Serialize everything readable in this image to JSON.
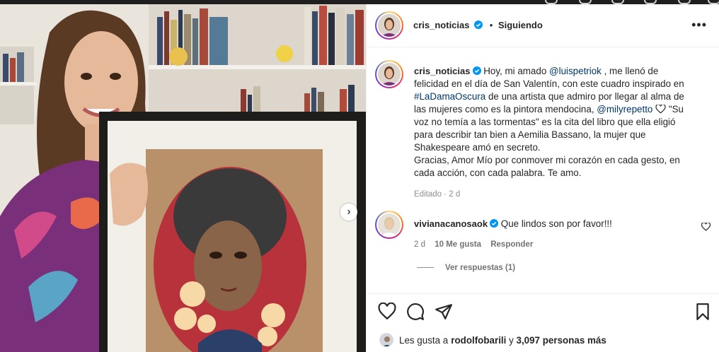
{
  "post": {
    "username": "cris_noticias",
    "follow_status": "Siguiendo",
    "more_label": "•••",
    "caption": {
      "username": "cris_noticias",
      "text_1": " Hoy, mi amado ",
      "mention_1": "@luispetriok",
      "text_2": " , me llenó de felicidad en el día de San Valentín, con este cuadro inspirado en ",
      "hashtag": "#LaDamaOscura",
      "text_3": " de una artista que admiro por llegar al alma de las mujeres como es la pintora mendocina, ",
      "mention_2": "@milyrepetto",
      "text_4": " \"Su voz no temía a las tormentas\" es la cita del libro que ella eligió para describir tan bien a Aemilia Bassano, la mujer que Shakespeare amó en secreto.",
      "text_5": "Gracias, Amor Mío por conmover mi corazón en cada gesto, en cada acción, con cada palabra. Te amo.",
      "edited": "Editado · 2 d"
    },
    "comment": {
      "username": "vivianacanosaok",
      "text": "Que lindos son por favor!!!",
      "age": "2 d",
      "likes": "10 Me gusta",
      "reply": "Responder",
      "view_replies": "Ver respuestas (1)"
    },
    "likes_summary": {
      "prefix": "Les gusta a ",
      "user": "rodolfobarili",
      "middle": " y ",
      "count": "3,097 personas más"
    }
  },
  "colors": {
    "link": "#00376b",
    "verified": "#0095f6",
    "muted": "#8e8e8e",
    "text": "#262626"
  },
  "icons": [
    "chevron-right-icon",
    "verified-icon",
    "heart-icon",
    "comment-icon",
    "share-icon",
    "bookmark-icon",
    "more-icon"
  ]
}
